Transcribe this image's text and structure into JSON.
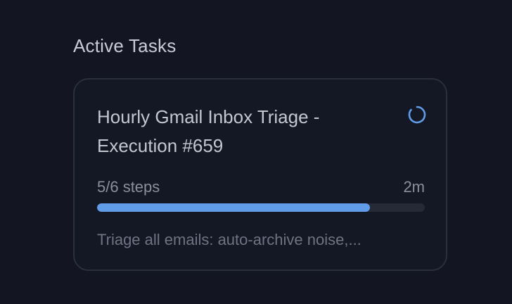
{
  "section": {
    "title": "Active Tasks"
  },
  "task": {
    "title_line1": "Hourly Gmail Inbox Triage -",
    "title_line2": "Execution #659",
    "steps_text": "5/6 steps",
    "elapsed": "2m",
    "progress_fraction": 0.833,
    "description": "Triage all emails: auto-archive noise,...",
    "status_icon": "loading-spinner-icon"
  },
  "colors": {
    "accent": "#609ce8",
    "background": "#131522",
    "card_border": "#2a2f3e"
  }
}
